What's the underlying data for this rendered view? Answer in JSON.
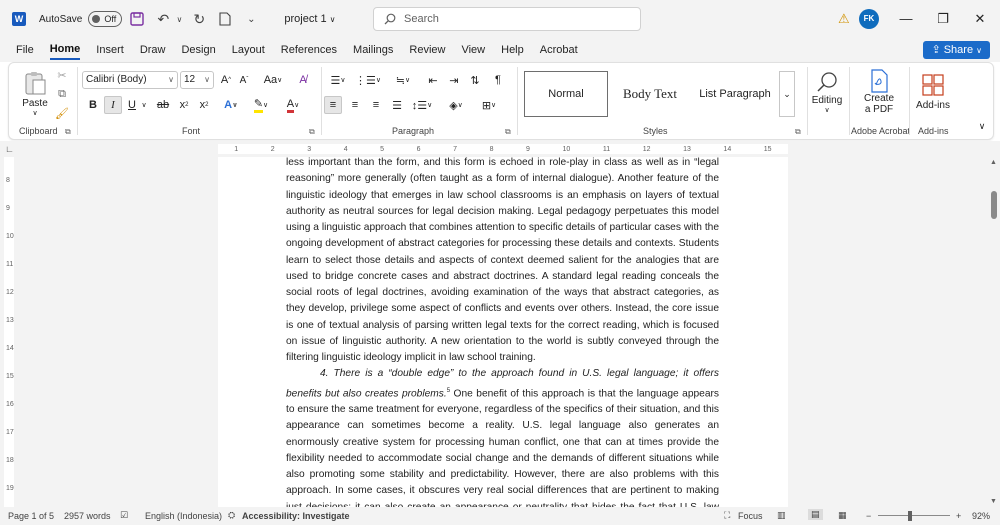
{
  "titlebar": {
    "autosave_label": "AutoSave",
    "autosave_state": "Off",
    "doc_title": "project 1",
    "doc_title_chevron": "∨",
    "search_placeholder": "Search",
    "avatar_initials": "FK"
  },
  "tabs": [
    "File",
    "Home",
    "Insert",
    "Draw",
    "Design",
    "Layout",
    "References",
    "Mailings",
    "Review",
    "View",
    "Help",
    "Acrobat"
  ],
  "share_label": "Share",
  "ribbon": {
    "clipboard": {
      "paste_label": "Paste",
      "group_label": "Clipboard"
    },
    "font": {
      "font_name": "Calibri (Body)",
      "font_size": "12",
      "group_label": "Font"
    },
    "paragraph": {
      "group_label": "Paragraph"
    },
    "styles": {
      "items": [
        "Normal",
        "Body Text",
        "List Paragraph"
      ],
      "group_label": "Styles"
    },
    "editing": {
      "label": "Editing"
    },
    "acrobat": {
      "label1": "Create",
      "label2": "a PDF",
      "group_label": "Adobe Acrobat"
    },
    "addins": {
      "label": "Add-ins",
      "group_label": "Add-ins"
    }
  },
  "ruler": {
    "ticks": [
      "1",
      "2",
      "3",
      "4",
      "5",
      "6",
      "7",
      "8",
      "9",
      "10",
      "11",
      "12",
      "13",
      "14",
      "15"
    ]
  },
  "vruler": {
    "ticks": [
      "8",
      "9",
      "10",
      "11",
      "12",
      "13",
      "14",
      "15",
      "16",
      "17",
      "18",
      "19"
    ]
  },
  "document": {
    "para1": "less important than the form, and this form is echoed in role-play in class as well as in “legal reasoning” more generally (often taught as a form of internal dialogue). Another feature of the linguistic ideology that emerges in law school classrooms is an emphasis on layers of textual authority as neutral sources for legal decision making. Legal pedagogy perpetuates this model using a linguistic approach that combines attention to specific details of particular cases with the ongoing development of abstract categories for processing these details and contexts. Students learn to select those details and aspects of context deemed salient for the analogies that are used to bridge concrete cases and abstract doctrines. A standard legal reading conceals the social roots of legal doctrines, avoiding examination of the ways that abstract categories, as they develop, privilege some aspect of conflicts and events over others. Instead, the core issue is one of textual analysis of parsing written legal texts for the correct reading, which is focused on issue of linguistic authority. A new orientation to the world is subtly conveyed through the filtering linguistic ideology implicit in law school training.",
    "para2_italic": "4. There is a “double edge” to the approach found in U.S. legal language; it offers benefits but also creates problems.",
    "para2_footnote": "5",
    "para2_rest": " One benefit of this approach is that the language appears to ensure the same treatment for everyone, regardless of the specifics of their situation, and this appearance can sometimes become a reality. U.S. legal language also generates an enormously creative system for processing human conflict, one that can at times provide the flexibility needed to accommodate social change and the demands of different situations while also promoting some stability and predictability. However, there are also problems with this approach. In some cases, it obscures very real social differences that are pertinent to making just decisions; it can also create an appearance or neutrality that hides the fact that U.S. law continues to enact social inequities and injustices"
  },
  "statusbar": {
    "page": "Page 1 of 5",
    "words": "2957 words",
    "language": "English (Indonesia)",
    "accessibility": "Accessibility: Investigate",
    "focus": "Focus",
    "zoom": "92%"
  },
  "colors": {
    "accent": "#185abd",
    "share_bg": "#1b6bc9",
    "avatar_bg": "#0f6cbd",
    "warning": "#d19200"
  }
}
